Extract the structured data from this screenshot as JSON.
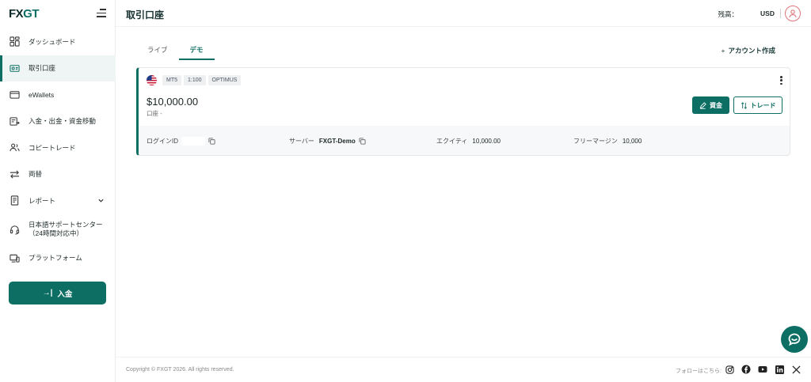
{
  "brand": {
    "part1": "FX",
    "part2": "GT"
  },
  "sidebar": {
    "items": [
      {
        "label": "ダッシュボード",
        "icon": "dashboard-icon"
      },
      {
        "label": "取引口座",
        "icon": "trading-account-icon",
        "active": true
      },
      {
        "label": "eWallets",
        "icon": "wallet-icon"
      },
      {
        "label": "入金・出金・資金移動",
        "icon": "funds-transfer-icon"
      },
      {
        "label": "コピートレード",
        "icon": "copy-trade-icon"
      },
      {
        "label": "両替",
        "icon": "exchange-icon"
      },
      {
        "label": "レポート",
        "icon": "report-icon"
      },
      {
        "label_line1": "日本語サポートセンター",
        "label_line2": "（24時間対応中）",
        "icon": "support-headset-icon"
      },
      {
        "label": "プラットフォーム",
        "icon": "platform-icon"
      }
    ],
    "deposit_button": "入金"
  },
  "header": {
    "title": "取引口座",
    "balance_label": "残高：",
    "currency": "USD"
  },
  "tabs": [
    {
      "label": "ライブ",
      "active": false
    },
    {
      "label": "デモ",
      "active": true
    }
  ],
  "create_account": "アカウント作成",
  "account": {
    "badges": [
      "MT5",
      "1:100",
      "OPTIMUS"
    ],
    "amount": "$10,000.00",
    "sub": "口座 -",
    "fund_button": "資金",
    "trade_button": "トレード",
    "login_label": "ログインID",
    "server_label": "サーバー",
    "server_value": "FXGT-Demo",
    "equity_label": "エクイティ",
    "equity_value": "10,000.00",
    "free_margin_label": "フリーマージン",
    "free_margin_value": "10,000"
  },
  "footer": {
    "copyright": "Copyright © FXGT 2026. All rights reserved.",
    "follow": "フォローはこちら:",
    "socials": [
      "instagram-icon",
      "facebook-icon",
      "youtube-icon",
      "linkedin-icon",
      "x-icon"
    ]
  },
  "colors": {
    "accent": "#0d6e64",
    "avatar_ring": "#e0747a"
  }
}
